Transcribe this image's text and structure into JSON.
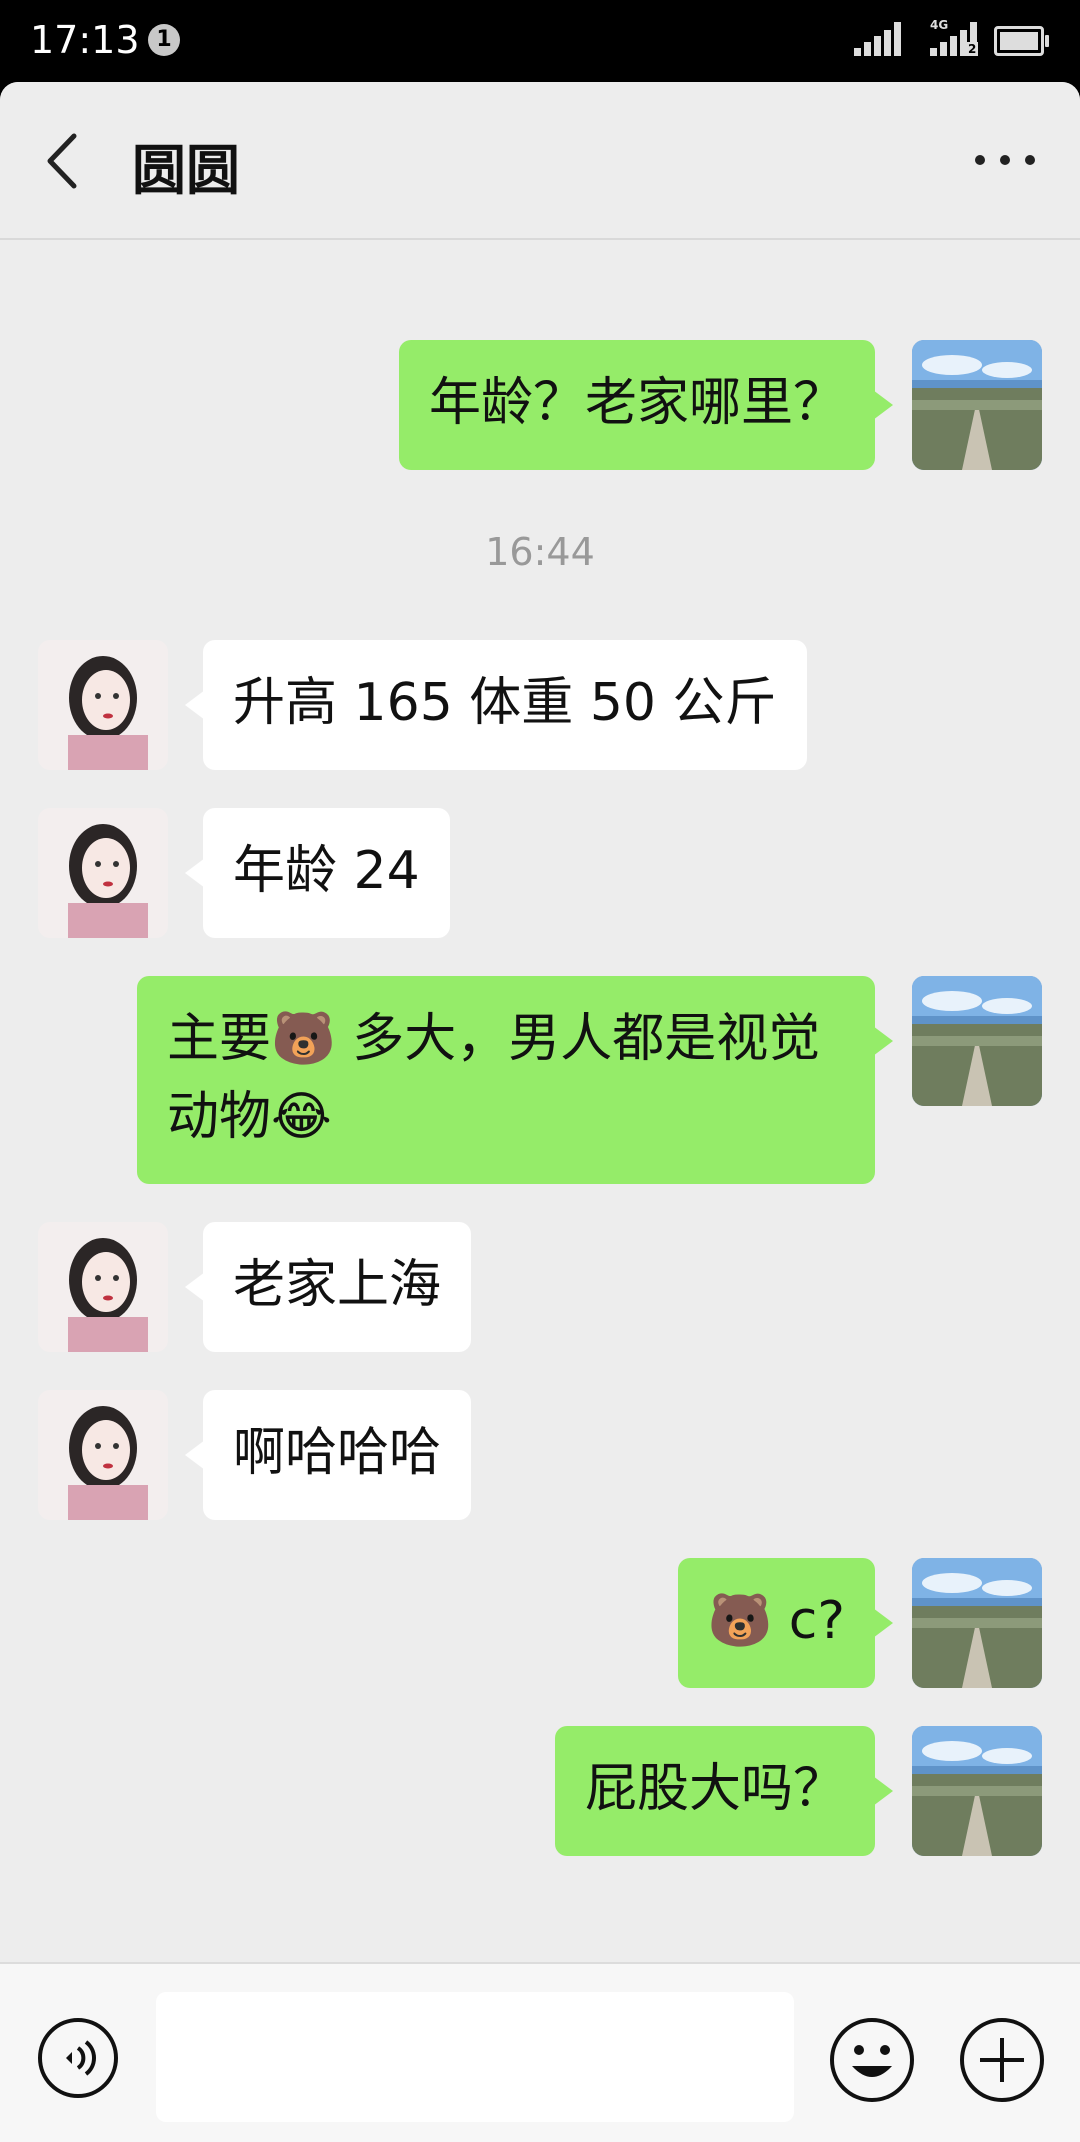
{
  "status_bar": {
    "time": "17:13",
    "notification_count": "1",
    "network_label": "4G",
    "sim_label": "2"
  },
  "header": {
    "title": "圆圆",
    "back_icon": "chevron-left-icon",
    "more_icon": "more-dots-icon"
  },
  "messages": [
    {
      "sender": "me",
      "text": "年龄？老家哪里？"
    },
    {
      "sender": "system",
      "text": "16:44"
    },
    {
      "sender": "her",
      "text": "升高 165 体重 50 公斤"
    },
    {
      "sender": "her",
      "text": "年龄 24"
    },
    {
      "sender": "me",
      "text": "主要🐻 多大，男人都是视觉\n动物😂"
    },
    {
      "sender": "her",
      "text": "老家上海"
    },
    {
      "sender": "her",
      "text": "啊哈哈哈"
    },
    {
      "sender": "me",
      "text": "🐻 c?"
    },
    {
      "sender": "me",
      "text": "屁股大吗？"
    },
    {
      "sender": "her",
      "type": "image"
    }
  ],
  "input_bar": {
    "voice_icon": "voice-icon",
    "emoji_icon": "emoji-icon",
    "plus_icon": "plus-icon",
    "input_value": ""
  },
  "colors": {
    "background": "#ededed",
    "my_bubble": "#95ec69",
    "her_bubble": "#ffffff",
    "status_bar": "#000000"
  }
}
